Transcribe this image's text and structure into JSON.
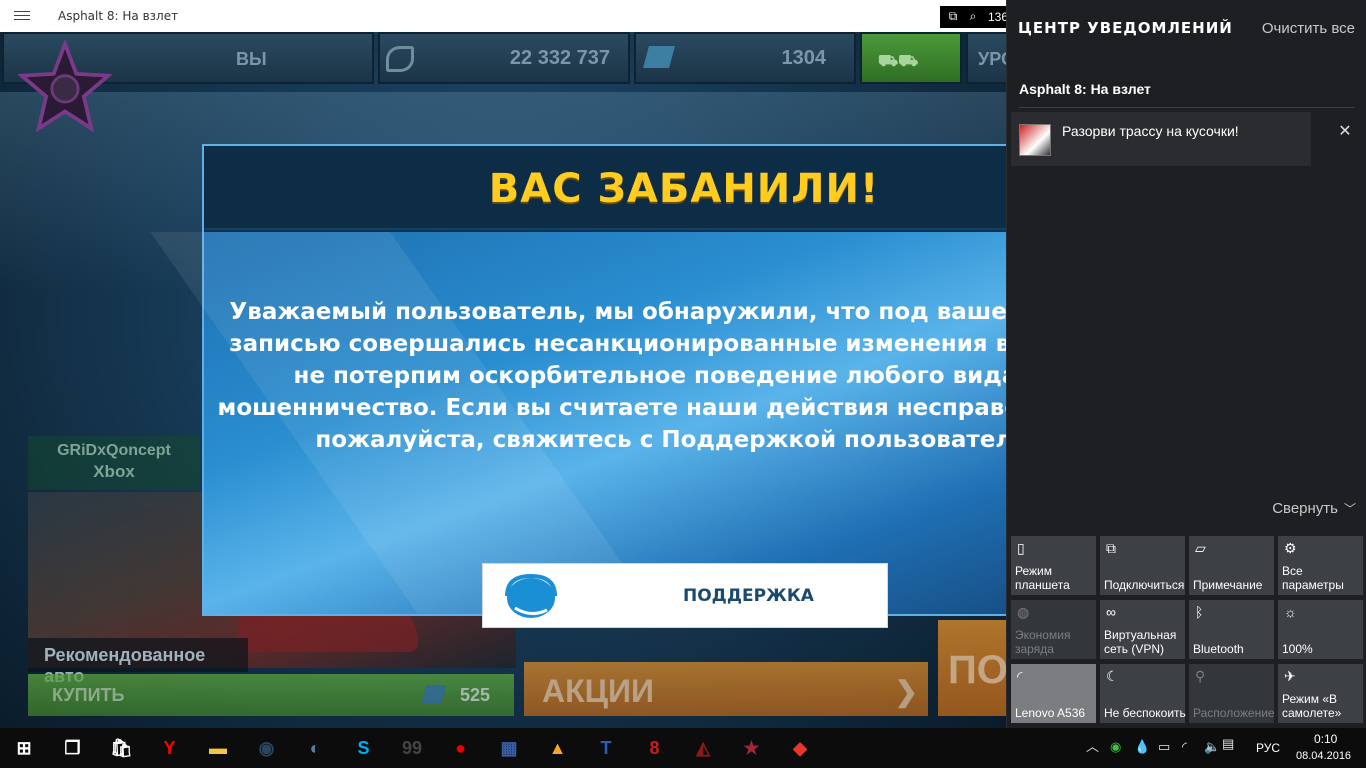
{
  "window": {
    "title": "Asphalt 8: На взлет",
    "zoom": "136"
  },
  "game": {
    "hud": {
      "you": "ВЫ",
      "credits": "22 332 737",
      "tokens": "1304",
      "level": "УРО"
    },
    "player": {
      "name": "GRiDxQoncept",
      "platform": "Xbox"
    },
    "recommended_label": "Рекомендованное авто",
    "buy": {
      "label": "КУПИТЬ",
      "price": "525"
    },
    "promo_label": "АКЦИИ",
    "play_label": "ПО"
  },
  "dialog": {
    "title": "ВАС ЗАБАНИЛИ!",
    "message": "Уважаемый пользователь, мы обнаружили, что под вашей учетной записью совершались несанкционированные изменения в игре. Мы не потерпим оскорбительное поведение любого вида или мошенничество. Если вы считаете наши действия несправедливыми, пожалуйста, свяжитесь с Поддержкой пользователей.",
    "support_label": "ПОДДЕРЖКА"
  },
  "action_center": {
    "title": "ЦЕНТР УВЕДОМЛЕНИЙ",
    "clear_all": "Очистить все",
    "app_name": "Asphalt 8: На взлет",
    "notification": "Разорви трассу на кусочки!",
    "collapse": "Свернуть",
    "tiles": [
      {
        "label": "Режим планшета",
        "icon": "tablet-icon",
        "glyph": "▯"
      },
      {
        "label": "Подключиться",
        "icon": "connect-icon",
        "glyph": "⧉"
      },
      {
        "label": "Примечание",
        "icon": "note-icon",
        "glyph": "▱"
      },
      {
        "label": "Все параметры",
        "icon": "gear-icon",
        "glyph": "⚙"
      },
      {
        "label": "Экономия заряда",
        "icon": "battery-saver-icon",
        "glyph": "◍"
      },
      {
        "label": "Виртуальная сеть (VPN)",
        "icon": "vpn-icon",
        "glyph": "∞"
      },
      {
        "label": "Bluetooth",
        "icon": "bluetooth-icon",
        "glyph": "ᛒ"
      },
      {
        "label": "100%",
        "icon": "brightness-icon",
        "glyph": "☼"
      },
      {
        "label": "Lenovo A536",
        "icon": "wifi-icon",
        "glyph": "◜"
      },
      {
        "label": "Не беспокоить",
        "icon": "moon-icon",
        "glyph": "☾"
      },
      {
        "label": "Расположение",
        "icon": "location-icon",
        "glyph": "⚲"
      },
      {
        "label": "Режим «В самолете»",
        "icon": "airplane-icon",
        "glyph": "✈"
      }
    ]
  },
  "taskbar": {
    "apps": [
      {
        "name": "start-button",
        "glyph": "⊞",
        "color": "#ffffff"
      },
      {
        "name": "task-view-button",
        "glyph": "❐",
        "color": "#ffffff"
      },
      {
        "name": "store-icon",
        "glyph": "🛍",
        "color": "#ffffff"
      },
      {
        "name": "yandex-browser-icon",
        "glyph": "Y",
        "color": "#ff0000"
      },
      {
        "name": "file-explorer-icon",
        "glyph": "▬",
        "color": "#f4c542"
      },
      {
        "name": "steam-icon",
        "glyph": "◉",
        "color": "#2a475e"
      },
      {
        "name": "app-icon-7",
        "glyph": "◐",
        "color": "#5a7a9a"
      },
      {
        "name": "skype-icon",
        "glyph": "S",
        "color": "#00aff0"
      },
      {
        "name": "app-icon-9",
        "glyph": "99",
        "color": "#444444"
      },
      {
        "name": "record-icon",
        "glyph": "●",
        "color": "#e60000"
      },
      {
        "name": "app-icon-11",
        "glyph": "▦",
        "color": "#3a5fa8"
      },
      {
        "name": "app-icon-12",
        "glyph": "▲",
        "color": "#f5a623"
      },
      {
        "name": "turbo-icon",
        "glyph": "T",
        "color": "#2b5db8"
      },
      {
        "name": "asphalt-8-icon",
        "glyph": "8",
        "color": "#c41e1e"
      },
      {
        "name": "racing-game-icon",
        "glyph": "◭",
        "color": "#8b1a1a"
      },
      {
        "name": "app-icon-16",
        "glyph": "★",
        "color": "#a0263a"
      },
      {
        "name": "app-icon-17",
        "glyph": "◆",
        "color": "#e8352e"
      }
    ],
    "language": "РУС",
    "time": "0:10",
    "date": "08.04.2016"
  }
}
